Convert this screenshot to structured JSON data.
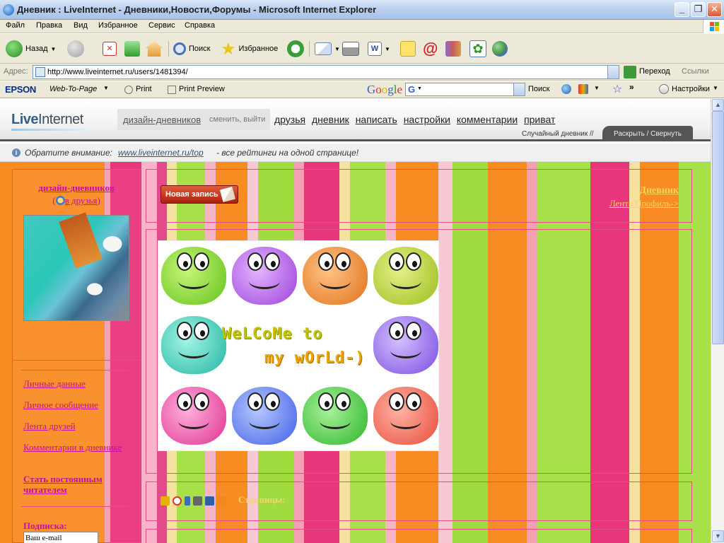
{
  "window": {
    "title": "Дневник : LiveInternet - Дневники,Новости,Форумы - Microsoft Internet Explorer",
    "min_label": "_",
    "max_label": "❐",
    "close_label": "✕"
  },
  "menu": [
    "Файл",
    "Правка",
    "Вид",
    "Избранное",
    "Сервис",
    "Справка"
  ],
  "toolbar": {
    "back_label": "Назад",
    "search_label": "Поиск",
    "favorites_label": "Избранное"
  },
  "address": {
    "label": "Адрес:",
    "url": "http://www.liveinternet.ru/users/1481394/",
    "go_label": "Переход",
    "links_label": "Ссылки"
  },
  "extbar": {
    "epson": "EPSON",
    "web_to_page": "Web-To-Page",
    "print": "Print",
    "print_preview": "Print Preview",
    "google_box": "G",
    "search_label": "Поиск",
    "settings_label": "Настройки"
  },
  "li_header": {
    "logo_a": "Live",
    "logo_b": "Internet",
    "username": "дизайн-дневников",
    "change_exit": "сменить, выйти",
    "nav": [
      "друзья",
      "дневник",
      "написать",
      "настройки",
      "комментарии",
      "приват"
    ],
    "random_diary": "Случайный дневник //",
    "expand_tab": "Раскрыть / Свернуть"
  },
  "notice": {
    "label": "Обратите внимание:",
    "link": "www.liveinternet.ru/top",
    "text": "- все рейтинги на одной странице!"
  },
  "sidebar": {
    "username": "дизайн-дневников",
    "friend_open": "(",
    "friend_label": "в друзья",
    "friend_close": ")",
    "links": [
      "Личные данные",
      "Личное сообщение",
      "Лента друзей",
      "Комментарии в дневнике"
    ],
    "subscribe_link": "Стать постоянным читателем",
    "subscription_label": "Подписка:",
    "email_placeholder": "Ваш e-mail"
  },
  "main": {
    "new_post": "Новая запись",
    "diary_label": "Дневник",
    "tab_feed": "Лента",
    "tab_profile": "Профиль->",
    "welcome_line1": "WeLCoMe to",
    "welcome_line2": "my wOrLd-)",
    "pages_label": "Страницы:"
  },
  "colors": {
    "link_magenta": "#c60fa3",
    "gold": "#fdd35a",
    "pink_border": "#e84b8a"
  }
}
